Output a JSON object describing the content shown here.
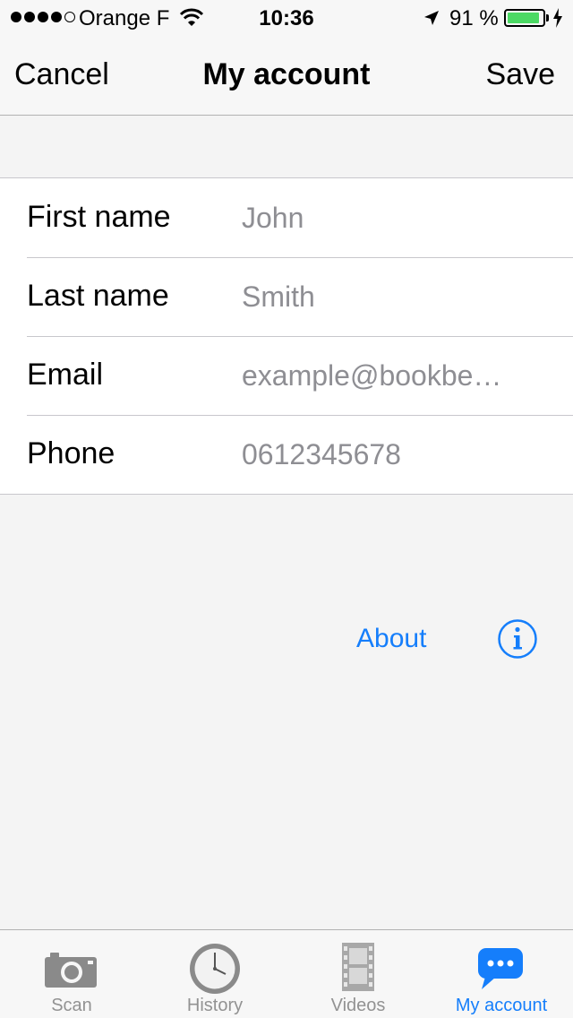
{
  "status_bar": {
    "carrier": "Orange F",
    "time": "10:36",
    "battery_percent": "91 %",
    "battery_level": 0.91,
    "signal_bars_filled": 4,
    "signal_bars_total": 5
  },
  "nav": {
    "left_label": "Cancel",
    "title": "My account",
    "right_label": "Save"
  },
  "form": {
    "rows": [
      {
        "label": "First name",
        "placeholder": "John"
      },
      {
        "label": "Last name",
        "placeholder": "Smith"
      },
      {
        "label": "Email",
        "placeholder": "example@bookbe…"
      },
      {
        "label": "Phone",
        "placeholder": "0612345678"
      }
    ]
  },
  "about": {
    "label": "About",
    "icon": "info-circle-icon"
  },
  "tabs": [
    {
      "label": "Scan",
      "icon": "camera-icon",
      "active": false
    },
    {
      "label": "History",
      "icon": "clock-icon",
      "active": false
    },
    {
      "label": "Videos",
      "icon": "film-icon",
      "active": false
    },
    {
      "label": "My account",
      "icon": "chat-bubble-icon",
      "active": true
    }
  ],
  "colors": {
    "accent": "#157efb",
    "battery": "#4cd964",
    "placeholder_text": "#8e8e93",
    "inactive_tab": "#929292",
    "background": "#f4f4f4"
  }
}
